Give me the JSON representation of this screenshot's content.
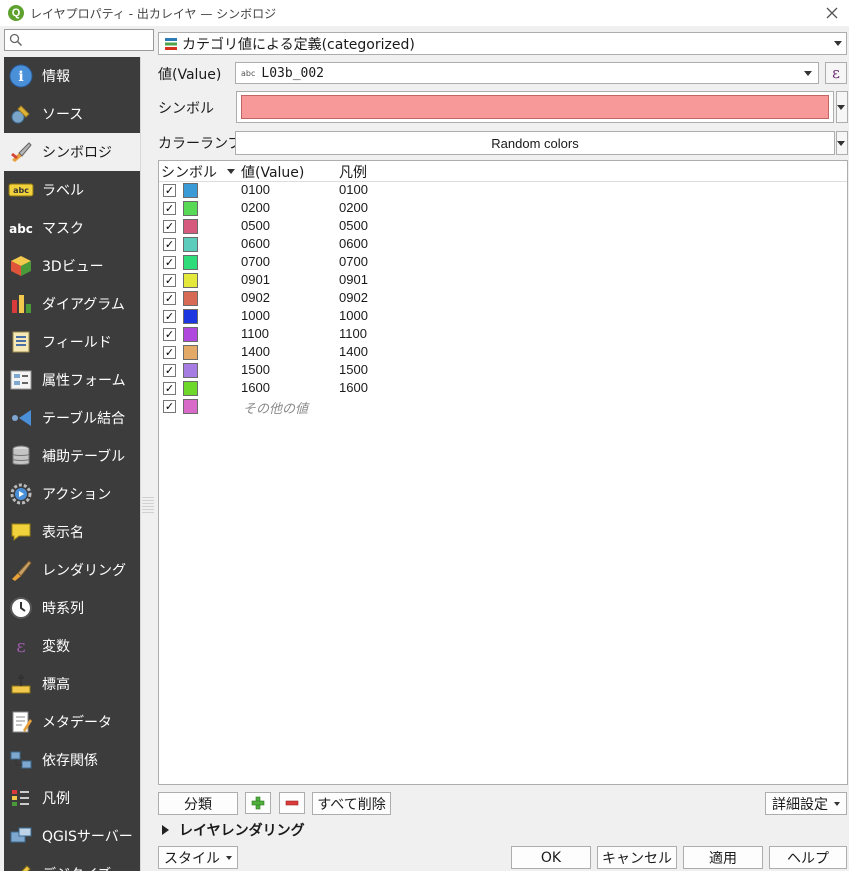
{
  "window": {
    "title": "レイヤプロパティ - 出カレイヤ — シンボロジ"
  },
  "sidebar": {
    "search_placeholder": "",
    "items": [
      {
        "label": "情報",
        "icon": "info-icon"
      },
      {
        "label": "ソース",
        "icon": "source-icon"
      },
      {
        "label": "シンボロジ",
        "icon": "symbology-icon",
        "active": true
      },
      {
        "label": "ラベル",
        "icon": "labels-icon"
      },
      {
        "label": "マスク",
        "icon": "mask-icon"
      },
      {
        "label": "3Dビュー",
        "icon": "3d-view-icon"
      },
      {
        "label": "ダイアグラム",
        "icon": "diagram-icon"
      },
      {
        "label": "フィールド",
        "icon": "fields-icon"
      },
      {
        "label": "属性フォーム",
        "icon": "attribute-form-icon"
      },
      {
        "label": "テーブル結合",
        "icon": "joins-icon"
      },
      {
        "label": "補助テーブル",
        "icon": "auxiliary-storage-icon"
      },
      {
        "label": "アクション",
        "icon": "actions-icon"
      },
      {
        "label": "表示名",
        "icon": "display-icon"
      },
      {
        "label": "レンダリング",
        "icon": "rendering-icon"
      },
      {
        "label": "時系列",
        "icon": "temporal-icon"
      },
      {
        "label": "変数",
        "icon": "variables-icon"
      },
      {
        "label": "標高",
        "icon": "elevation-icon"
      },
      {
        "label": "メタデータ",
        "icon": "metadata-icon"
      },
      {
        "label": "依存関係",
        "icon": "dependencies-icon"
      },
      {
        "label": "凡例",
        "icon": "legend-icon"
      },
      {
        "label": "QGISサーバー",
        "icon": "qgis-server-icon"
      },
      {
        "label": "デジタイズ",
        "icon": "digitizing-icon"
      }
    ]
  },
  "renderer": {
    "label": "カテゴリ値による定義(categorized)"
  },
  "value_row": {
    "label": "値(Value)",
    "field_type": "abc",
    "field": "L03b_002",
    "expr_symbol": "ε"
  },
  "symbol_row": {
    "label": "シンボル",
    "color": "#f79999"
  },
  "ramp_row": {
    "label": "カラーランプ",
    "value": "Random colors"
  },
  "table": {
    "headers": {
      "symbol": "シンボル",
      "value": "値(Value)",
      "legend": "凡例"
    },
    "rows": [
      {
        "value": "0100",
        "legend": "0100",
        "color": "#3a9ad6",
        "checked": true
      },
      {
        "value": "0200",
        "legend": "0200",
        "color": "#58d955",
        "checked": true
      },
      {
        "value": "0500",
        "legend": "0500",
        "color": "#d65a7e",
        "checked": true
      },
      {
        "value": "0600",
        "legend": "0600",
        "color": "#5ccdbc",
        "checked": true
      },
      {
        "value": "0700",
        "legend": "0700",
        "color": "#2edc7a",
        "checked": true
      },
      {
        "value": "0901",
        "legend": "0901",
        "color": "#e4e83a",
        "checked": true
      },
      {
        "value": "0902",
        "legend": "0902",
        "color": "#d66a55",
        "checked": true
      },
      {
        "value": "1000",
        "legend": "1000",
        "color": "#1c36e0",
        "checked": true
      },
      {
        "value": "1100",
        "legend": "1100",
        "color": "#b048de",
        "checked": true
      },
      {
        "value": "1400",
        "legend": "1400",
        "color": "#e2aa66",
        "checked": true
      },
      {
        "value": "1500",
        "legend": "1500",
        "color": "#a67ce2",
        "checked": true
      },
      {
        "value": "1600",
        "legend": "1600",
        "color": "#6ed82a",
        "checked": true
      }
    ],
    "other_row": {
      "label": "その他の値",
      "color": "#d86ac8",
      "checked": true
    },
    "check_mark": "✓"
  },
  "buttons": {
    "classify": "分類",
    "add": "+",
    "remove": "−",
    "delete_all": "すべて削除",
    "advanced": "詳細設定",
    "style": "スタイル",
    "ok": "OK",
    "cancel": "キャンセル",
    "apply": "適用",
    "help": "ヘルプ"
  },
  "layer_rendering": {
    "label": "レイヤレンダリング"
  }
}
